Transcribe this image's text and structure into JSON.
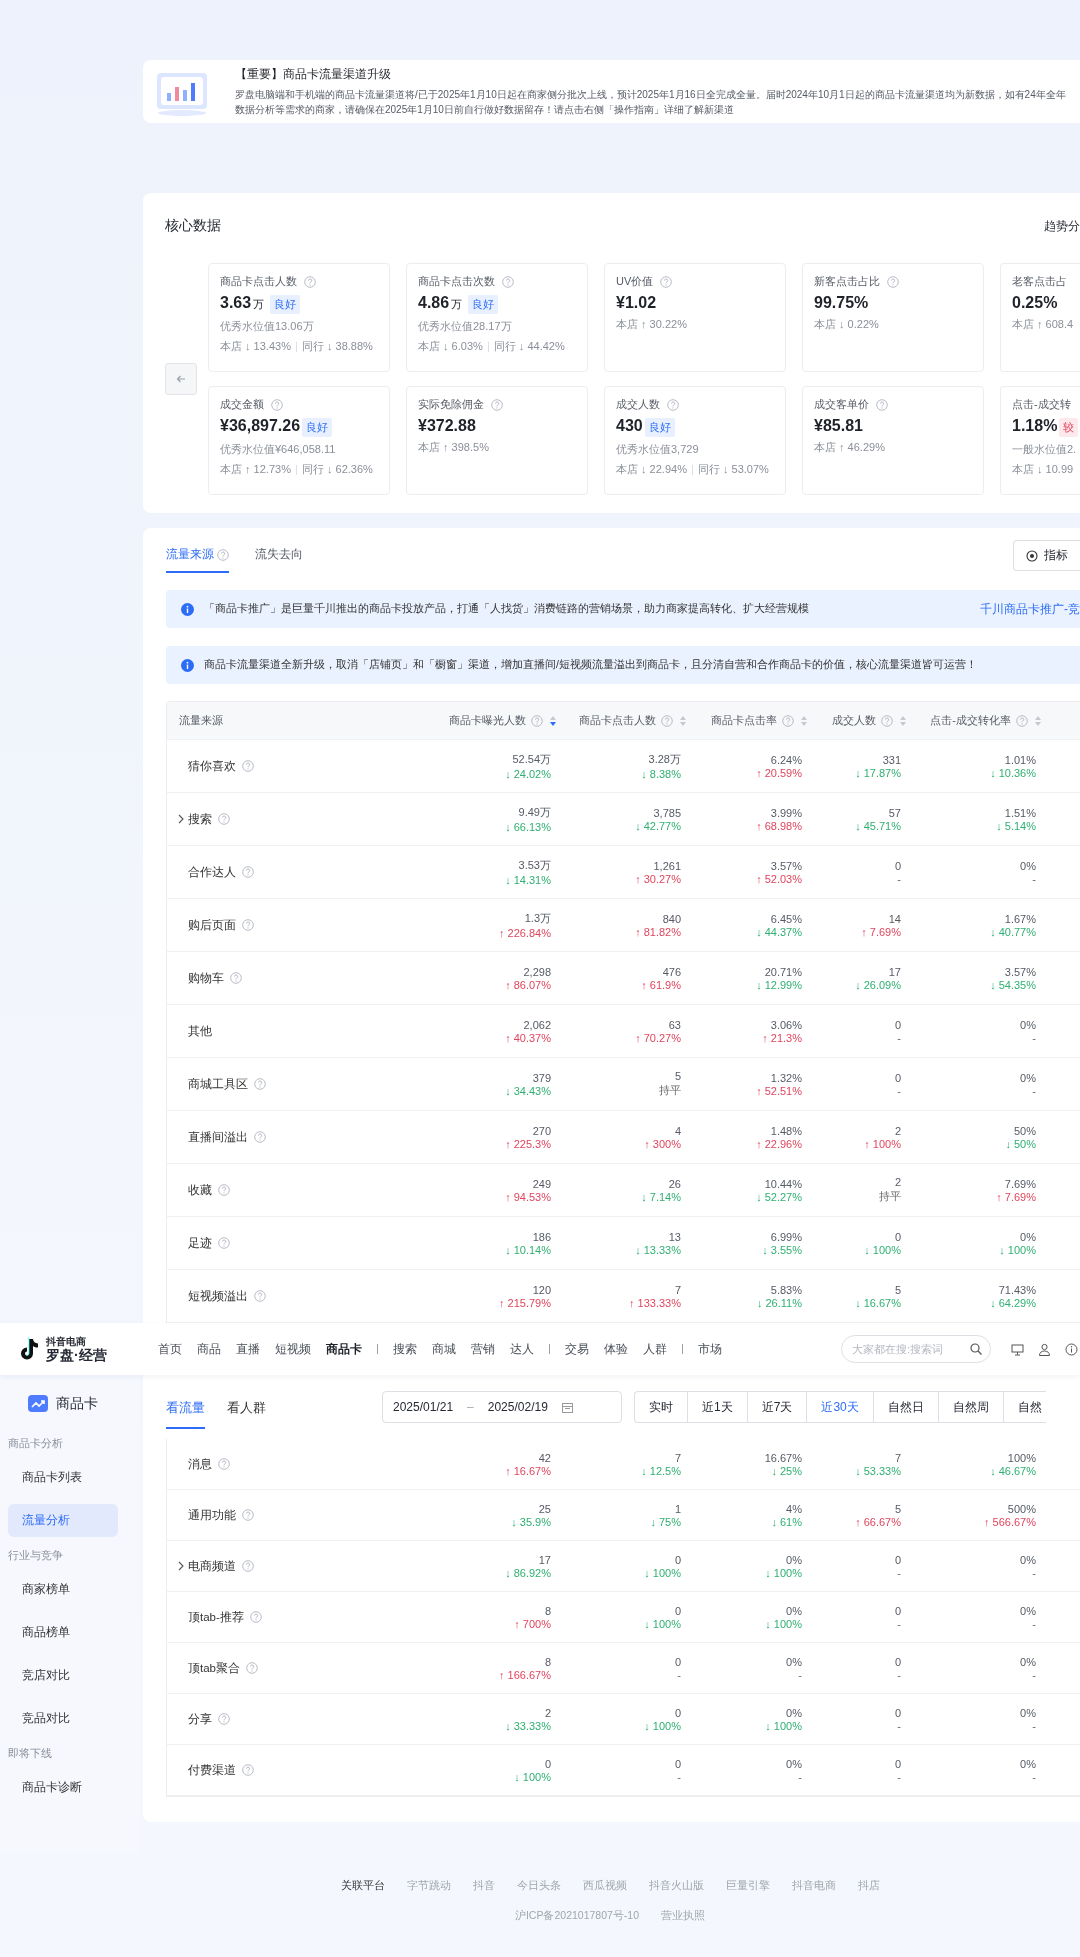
{
  "banner": {
    "title": "【重要】商品卡流量渠道升级",
    "body": "罗盘电脑端和手机端的商品卡流量渠道将/已于2025年1月10日起在商家侧分批次上线，预计2025年1月16日全完成全量。届时2024年10月1日起的商品卡流量渠道均为新数据，如有24年全年数据分析等需求的商家，请确保在2025年1月10日前自行做好数据留存！请点击右侧「操作指南」详细了解新渠道"
  },
  "core": {
    "title": "核心数据",
    "action": "趋势分",
    "metrics": [
      {
        "label": "商品卡点击人数",
        "help": true,
        "value": "3.63",
        "unit": "万",
        "badge": {
          "text": "良好",
          "negative": false
        },
        "benchmark": "优秀水位值13.06万",
        "store": "本店 ↓ 13.43%",
        "peer": "同行 ↓ 38.88%"
      },
      {
        "label": "商品卡点击次数",
        "help": true,
        "value": "4.86",
        "unit": "万",
        "badge": {
          "text": "良好",
          "negative": false
        },
        "benchmark": "优秀水位值28.17万",
        "store": "本店 ↓ 6.03%",
        "peer": "同行 ↓ 44.42%"
      },
      {
        "label": "UV价值",
        "help": true,
        "value": "¥1.02",
        "store": "本店 ↑ 30.22%"
      },
      {
        "label": "新客点击占比",
        "help": true,
        "value": "99.75%",
        "store": "本店 ↓ 0.22%"
      },
      {
        "label": "老客点击占",
        "help": false,
        "value": "0.25%",
        "store": "本店 ↑ 608.4"
      },
      {
        "label": "成交金额",
        "help": true,
        "value": "¥36,897.26",
        "badge": {
          "text": "良好",
          "negative": false
        },
        "benchmark": "优秀水位值¥646,058.11",
        "store": "本店 ↑ 12.73%",
        "peer": "同行 ↓ 62.36%"
      },
      {
        "label": "实际免除佣金",
        "help": true,
        "value": "¥372.88",
        "store": "本店 ↑ 398.5%"
      },
      {
        "label": "成交人数",
        "help": true,
        "value": "430",
        "badge": {
          "text": "良好",
          "negative": false
        },
        "benchmark": "优秀水位值3,729",
        "store": "本店 ↓ 22.94%",
        "peer": "同行 ↓ 53.07%"
      },
      {
        "label": "成交客单价",
        "help": true,
        "value": "¥85.81",
        "store": "本店 ↑ 46.29%"
      },
      {
        "label": "点击-成交转",
        "help": false,
        "value": "1.18%",
        "badge": {
          "text": "较",
          "negative": true
        },
        "benchmark": "一般水位值2.",
        "store": "本店 ↓ 10.99"
      }
    ]
  },
  "traffic": {
    "tabs": [
      {
        "label": "流量来源",
        "help": true,
        "selected": true
      },
      {
        "label": "流失去向",
        "help": false,
        "selected": false
      }
    ],
    "button": "指标",
    "notices": [
      {
        "text": "「商品卡推广」是巨量千川推出的商品卡投放产品，打通「人找货」消费链路的营销场景，助力商家提高转化、扩大经营规模",
        "link": "千川商品卡推广-竞"
      },
      {
        "text": "商品卡流量渠道全新升级，取消「店铺页」和「橱窗」渠道，增加直播间/短视频流量溢出到商品卡，且分清自营和合作商品卡的价值，核心流量渠道皆可运营！"
      }
    ]
  },
  "table": {
    "columns": [
      {
        "label": "流量来源",
        "help": false
      },
      {
        "label": "商品卡曝光人数",
        "help": true,
        "sorted_desc": true
      },
      {
        "label": "商品卡点击人数",
        "help": true,
        "sorted_desc": false
      },
      {
        "label": "商品卡点击率",
        "help": true,
        "sorted_desc": false
      },
      {
        "label": "成交人数",
        "help": true,
        "sorted_desc": false
      },
      {
        "label": "点击-成交转化率",
        "help": true,
        "sorted_desc": false
      }
    ],
    "rows": [
      {
        "name": "猜你喜欢",
        "help": true,
        "expandable": false,
        "cells": [
          {
            "value": "52.54万",
            "change": "↓ 24.02%",
            "kind": "down"
          },
          {
            "value": "3.28万",
            "change": "↓ 8.38%",
            "kind": "down"
          },
          {
            "value": "6.24%",
            "change": "↑ 20.59%",
            "kind": "up"
          },
          {
            "value": "331",
            "change": "↓ 17.87%",
            "kind": "down"
          },
          {
            "value": "1.01%",
            "change": "↓ 10.36%",
            "kind": "down"
          }
        ]
      },
      {
        "name": "搜索",
        "help": true,
        "expandable": true,
        "cells": [
          {
            "value": "9.49万",
            "change": "↓ 66.13%",
            "kind": "down"
          },
          {
            "value": "3,785",
            "change": "↓ 42.77%",
            "kind": "down"
          },
          {
            "value": "3.99%",
            "change": "↑ 68.98%",
            "kind": "up"
          },
          {
            "value": "57",
            "change": "↓ 45.71%",
            "kind": "down"
          },
          {
            "value": "1.51%",
            "change": "↓ 5.14%",
            "kind": "down"
          }
        ]
      },
      {
        "name": "合作达人",
        "help": true,
        "expandable": false,
        "cells": [
          {
            "value": "3.53万",
            "change": "↓ 14.31%",
            "kind": "down"
          },
          {
            "value": "1,261",
            "change": "↑ 30.27%",
            "kind": "up"
          },
          {
            "value": "3.57%",
            "change": "↑ 52.03%",
            "kind": "up"
          },
          {
            "value": "0",
            "change": "-",
            "kind": "none"
          },
          {
            "value": "0%",
            "change": "-",
            "kind": "none"
          }
        ]
      },
      {
        "name": "购后页面",
        "help": true,
        "expandable": false,
        "cells": [
          {
            "value": "1.3万",
            "change": "↑ 226.84%",
            "kind": "up"
          },
          {
            "value": "840",
            "change": "↑ 81.82%",
            "kind": "up"
          },
          {
            "value": "6.45%",
            "change": "↓ 44.37%",
            "kind": "down"
          },
          {
            "value": "14",
            "change": "↑ 7.69%",
            "kind": "up"
          },
          {
            "value": "1.67%",
            "change": "↓ 40.77%",
            "kind": "down"
          }
        ]
      },
      {
        "name": "购物车",
        "help": true,
        "expandable": false,
        "cells": [
          {
            "value": "2,298",
            "change": "↑ 86.07%",
            "kind": "up"
          },
          {
            "value": "476",
            "change": "↑ 61.9%",
            "kind": "up"
          },
          {
            "value": "20.71%",
            "change": "↓ 12.99%",
            "kind": "down"
          },
          {
            "value": "17",
            "change": "↓ 26.09%",
            "kind": "down"
          },
          {
            "value": "3.57%",
            "change": "↓ 54.35%",
            "kind": "down"
          }
        ]
      },
      {
        "name": "其他",
        "help": false,
        "expandable": false,
        "cells": [
          {
            "value": "2,062",
            "change": "↑ 40.37%",
            "kind": "up"
          },
          {
            "value": "63",
            "change": "↑ 70.27%",
            "kind": "up"
          },
          {
            "value": "3.06%",
            "change": "↑ 21.3%",
            "kind": "up"
          },
          {
            "value": "0",
            "change": "-",
            "kind": "none"
          },
          {
            "value": "0%",
            "change": "-",
            "kind": "none"
          }
        ]
      },
      {
        "name": "商城工具区",
        "help": true,
        "expandable": false,
        "cells": [
          {
            "value": "379",
            "change": "↓ 34.43%",
            "kind": "down"
          },
          {
            "value": "5",
            "change": "持平",
            "kind": "flat"
          },
          {
            "value": "1.32%",
            "change": "↑ 52.51%",
            "kind": "up"
          },
          {
            "value": "0",
            "change": "-",
            "kind": "none"
          },
          {
            "value": "0%",
            "change": "-",
            "kind": "none"
          }
        ]
      },
      {
        "name": "直播间溢出",
        "help": true,
        "expandable": false,
        "cells": [
          {
            "value": "270",
            "change": "↑ 225.3%",
            "kind": "up"
          },
          {
            "value": "4",
            "change": "↑ 300%",
            "kind": "up"
          },
          {
            "value": "1.48%",
            "change": "↑ 22.96%",
            "kind": "up"
          },
          {
            "value": "2",
            "change": "↑ 100%",
            "kind": "up"
          },
          {
            "value": "50%",
            "change": "↓ 50%",
            "kind": "down"
          }
        ]
      },
      {
        "name": "收藏",
        "help": true,
        "expandable": false,
        "cells": [
          {
            "value": "249",
            "change": "↑ 94.53%",
            "kind": "up"
          },
          {
            "value": "26",
            "change": "↓ 7.14%",
            "kind": "down"
          },
          {
            "value": "10.44%",
            "change": "↓ 52.27%",
            "kind": "down"
          },
          {
            "value": "2",
            "change": "持平",
            "kind": "flat"
          },
          {
            "value": "7.69%",
            "change": "↑ 7.69%",
            "kind": "up"
          }
        ]
      },
      {
        "name": "足迹",
        "help": true,
        "expandable": false,
        "cells": [
          {
            "value": "186",
            "change": "↓ 10.14%",
            "kind": "down"
          },
          {
            "value": "13",
            "change": "↓ 13.33%",
            "kind": "down"
          },
          {
            "value": "6.99%",
            "change": "↓ 3.55%",
            "kind": "down"
          },
          {
            "value": "0",
            "change": "↓ 100%",
            "kind": "down"
          },
          {
            "value": "0%",
            "change": "↓ 100%",
            "kind": "down"
          }
        ]
      },
      {
        "name": "短视频溢出",
        "help": true,
        "expandable": false,
        "cells": [
          {
            "value": "120",
            "change": "↑ 215.79%",
            "kind": "up"
          },
          {
            "value": "7",
            "change": "↑ 133.33%",
            "kind": "up"
          },
          {
            "value": "5.83%",
            "change": "↓ 26.11%",
            "kind": "down"
          },
          {
            "value": "5",
            "change": "↓ 16.67%",
            "kind": "down"
          },
          {
            "value": "71.43%",
            "change": "↓ 64.29%",
            "kind": "down"
          }
        ]
      }
    ]
  },
  "nav": {
    "logo_small": "抖音电商",
    "logo": "罗盘·经营",
    "groups": [
      [
        {
          "label": "首页",
          "selected": false
        },
        {
          "label": "商品",
          "selected": false
        },
        {
          "label": "直播",
          "selected": false
        },
        {
          "label": "短视频",
          "selected": false
        },
        {
          "label": "商品卡",
          "selected": true
        }
      ],
      [
        {
          "label": "搜索",
          "selected": false
        },
        {
          "label": "商城",
          "selected": false
        },
        {
          "label": "营销",
          "selected": false
        },
        {
          "label": "达人",
          "selected": false
        }
      ],
      [
        {
          "label": "交易",
          "selected": false
        },
        {
          "label": "体验",
          "selected": false
        },
        {
          "label": "人群",
          "selected": false
        }
      ],
      [
        {
          "label": "市场",
          "selected": false
        }
      ]
    ],
    "search": {
      "placeholder": "大家都在搜:搜索词"
    }
  },
  "sidebar": {
    "title": "商品卡",
    "groups": [
      {
        "label": "商品卡分析",
        "items": [
          {
            "label": "商品卡列表",
            "selected": false
          },
          {
            "label": "流量分析",
            "selected": true
          }
        ]
      },
      {
        "label": "行业与竞争",
        "items": [
          {
            "label": "商家榜单",
            "selected": false
          },
          {
            "label": "商品榜单",
            "selected": false
          },
          {
            "label": "竞店对比",
            "selected": false
          },
          {
            "label": "竞品对比",
            "selected": false
          }
        ]
      },
      {
        "label": "即将下线",
        "items": [
          {
            "label": "商品卡诊断",
            "selected": false
          }
        ]
      }
    ]
  },
  "view": {
    "tabs": [
      {
        "label": "看流量",
        "selected": true
      },
      {
        "label": "看人群",
        "selected": false
      }
    ],
    "date_from": "2025/01/21",
    "date_sep": "–",
    "date_to": "2025/02/19",
    "ranges": [
      {
        "label": "实时",
        "selected": false
      },
      {
        "label": "近1天",
        "selected": false
      },
      {
        "label": "近7天",
        "selected": false
      },
      {
        "label": "近30天",
        "selected": true
      },
      {
        "label": "自然日",
        "selected": false
      },
      {
        "label": "自然周",
        "selected": false
      },
      {
        "label": "自然",
        "selected": false
      }
    ]
  },
  "table_continued": {
    "rows": [
      {
        "name": "消息",
        "help": true,
        "expandable": false,
        "cells": [
          {
            "value": "42",
            "change": "↑ 16.67%",
            "kind": "up"
          },
          {
            "value": "7",
            "change": "↓ 12.5%",
            "kind": "down"
          },
          {
            "value": "16.67%",
            "change": "↓ 25%",
            "kind": "down"
          },
          {
            "value": "7",
            "change": "↓ 53.33%",
            "kind": "down"
          },
          {
            "value": "100%",
            "change": "↓ 46.67%",
            "kind": "down"
          }
        ]
      },
      {
        "name": "通用功能",
        "help": true,
        "expandable": false,
        "cells": [
          {
            "value": "25",
            "change": "↓ 35.9%",
            "kind": "down"
          },
          {
            "value": "1",
            "change": "↓ 75%",
            "kind": "down"
          },
          {
            "value": "4%",
            "change": "↓ 61%",
            "kind": "down"
          },
          {
            "value": "5",
            "change": "↑ 66.67%",
            "kind": "up"
          },
          {
            "value": "500%",
            "change": "↑ 566.67%",
            "kind": "up"
          }
        ]
      },
      {
        "name": "电商频道",
        "help": true,
        "expandable": true,
        "cells": [
          {
            "value": "17",
            "change": "↓ 86.92%",
            "kind": "down"
          },
          {
            "value": "0",
            "change": "↓ 100%",
            "kind": "down"
          },
          {
            "value": "0%",
            "change": "↓ 100%",
            "kind": "down"
          },
          {
            "value": "0",
            "change": "-",
            "kind": "none"
          },
          {
            "value": "0%",
            "change": "-",
            "kind": "none"
          }
        ]
      },
      {
        "name": "顶tab-推荐",
        "help": true,
        "expandable": false,
        "cells": [
          {
            "value": "8",
            "change": "↑ 700%",
            "kind": "up"
          },
          {
            "value": "0",
            "change": "↓ 100%",
            "kind": "down"
          },
          {
            "value": "0%",
            "change": "↓ 100%",
            "kind": "down"
          },
          {
            "value": "0",
            "change": "-",
            "kind": "none"
          },
          {
            "value": "0%",
            "change": "-",
            "kind": "none"
          }
        ]
      },
      {
        "name": "顶tab聚合",
        "help": true,
        "expandable": false,
        "cells": [
          {
            "value": "8",
            "change": "↑ 166.67%",
            "kind": "up"
          },
          {
            "value": "0",
            "change": "-",
            "kind": "none"
          },
          {
            "value": "0%",
            "change": "-",
            "kind": "none"
          },
          {
            "value": "0",
            "change": "-",
            "kind": "none"
          },
          {
            "value": "0%",
            "change": "-",
            "kind": "none"
          }
        ]
      },
      {
        "name": "分享",
        "help": true,
        "expandable": false,
        "cells": [
          {
            "value": "2",
            "change": "↓ 33.33%",
            "kind": "down"
          },
          {
            "value": "0",
            "change": "↓ 100%",
            "kind": "down"
          },
          {
            "value": "0%",
            "change": "↓ 100%",
            "kind": "down"
          },
          {
            "value": "0",
            "change": "-",
            "kind": "none"
          },
          {
            "value": "0%",
            "change": "-",
            "kind": "none"
          }
        ]
      },
      {
        "name": "付费渠道",
        "help": true,
        "expandable": false,
        "cells": [
          {
            "value": "0",
            "change": "↓ 100%",
            "kind": "down"
          },
          {
            "value": "0",
            "change": "-",
            "kind": "none"
          },
          {
            "value": "0%",
            "change": "-",
            "kind": "none"
          },
          {
            "value": "0",
            "change": "-",
            "kind": "none"
          },
          {
            "value": "0%",
            "change": "-",
            "kind": "none"
          }
        ]
      }
    ]
  },
  "footer": {
    "label": "关联平台",
    "links": [
      "字节跳动",
      "抖音",
      "今日头条",
      "西瓜视频",
      "抖音火山版",
      "巨量引擎",
      "抖音电商",
      "抖店"
    ],
    "icp": "沪ICP备2021017807号-10",
    "license": "营业执照"
  }
}
